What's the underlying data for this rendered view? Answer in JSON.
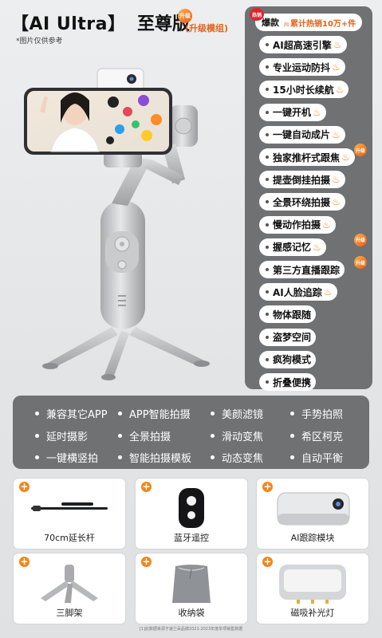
{
  "header": {
    "title_open": "【",
    "title_main": "AI Ultra",
    "title_close": "】",
    "edition": "至尊版",
    "upgrade_badge": "升级",
    "module_note": "(升级模组)",
    "note": "*图片仅供参考"
  },
  "hot": {
    "badge_text": "热销",
    "label": "爆款",
    "prefix": "川",
    "sales": "累计热销10万+件"
  },
  "features": [
    {
      "label": "AI超高速引擎",
      "flame": true
    },
    {
      "label": "专业运动防抖",
      "flame": true
    },
    {
      "label": "15小时长续航",
      "flame": true
    },
    {
      "label": "一键开机",
      "flame": true
    },
    {
      "label": "一键自动成片",
      "flame": true
    },
    {
      "label": "独家推杆式跟焦",
      "flame": true,
      "badge": "升级"
    },
    {
      "label": "提壶倒挂拍摄",
      "flame": true
    },
    {
      "label": "全景环绕拍摄",
      "flame": true
    },
    {
      "label": "慢动作拍摄",
      "flame": true
    },
    {
      "label": "握感记忆",
      "flame": true,
      "badge": "升级"
    },
    {
      "label": "第三方直播跟踪",
      "flame": false,
      "badge": "升级"
    },
    {
      "label": "AI人脸追踪",
      "flame": true
    },
    {
      "label": "物体跟随",
      "flame": false
    },
    {
      "label": "盗梦空间",
      "flame": false
    },
    {
      "label": "疯狗模式",
      "flame": false
    },
    {
      "label": "折叠便携",
      "flame": false
    }
  ],
  "capabilities": [
    "兼容其它APP",
    "APP智能拍摄",
    "美颜滤镜",
    "手势拍照",
    "延时摄影",
    "全景拍摄",
    "滑动变焦",
    "希区柯克",
    "一键横竖拍",
    "智能拍摄模板",
    "动态变焦",
    "自动平衡"
  ],
  "accessories": [
    {
      "label": "70cm延长杆",
      "icon": "extension-rod-icon"
    },
    {
      "label": "蓝牙遥控",
      "icon": "bluetooth-remote-icon"
    },
    {
      "label": "AI跟踪模块",
      "icon": "ai-tracking-module-icon"
    },
    {
      "label": "三脚架",
      "icon": "tripod-icon"
    },
    {
      "label": "收纳袋",
      "icon": "storage-bag-icon"
    },
    {
      "label": "磁吸补光灯",
      "icon": "fill-light-icon"
    }
  ],
  "footer": "[1]此数据来源于速兰朵品牌2021-2023年度单项销售数据",
  "colors": {
    "panel": "#6f7173",
    "accent": "#f0861c",
    "hot_red": "#e0232b"
  }
}
